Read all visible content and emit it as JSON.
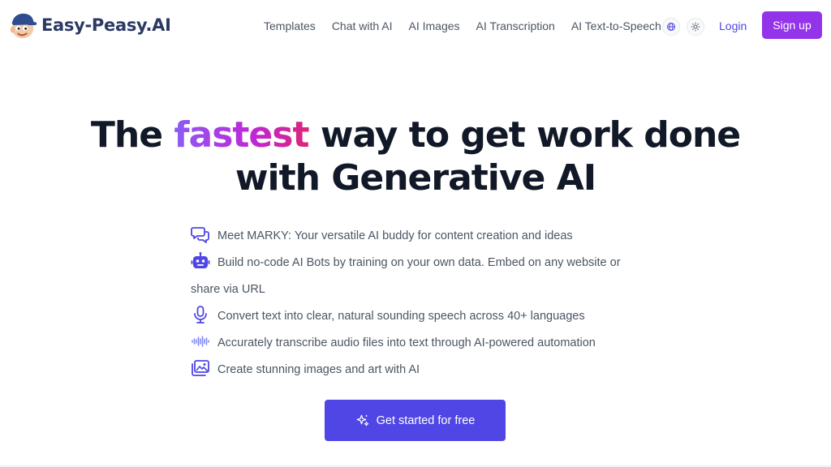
{
  "header": {
    "brand": "Easy-Peasy.AI",
    "nav": [
      "Templates",
      "Chat with AI",
      "AI Images",
      "AI Transcription",
      "AI Text-to-Speech"
    ],
    "login": "Login",
    "signup": "Sign up"
  },
  "hero": {
    "title_prefix": "The ",
    "title_highlight": "fastest",
    "title_line1_rest": " way to get work done",
    "title_line2": "with Generative AI"
  },
  "features": [
    {
      "icon": "chat-bubbles-icon",
      "text": "Meet MARKY: Your versatile AI buddy for content creation and ideas"
    },
    {
      "icon": "robot-icon",
      "text": "Build no-code AI Bots by training on your own data. Embed on any website or share via URL"
    },
    {
      "icon": "microphone-icon",
      "text": "Convert text into clear, natural sounding speech across 40+ languages"
    },
    {
      "icon": "sound-wave-icon",
      "text": "Accurately transcribe audio files into text through AI-powered automation"
    },
    {
      "icon": "images-icon",
      "text": "Create stunning images and art with AI"
    }
  ],
  "cta": {
    "label": "Get started for free",
    "icon": "sparkles-icon"
  },
  "colors": {
    "brand_text": "#2b3a63",
    "accent": "#4f46e5",
    "signup_bg": "#9333ea",
    "gradient": [
      "#8b5cf6",
      "#c026d3",
      "#db2777"
    ]
  }
}
